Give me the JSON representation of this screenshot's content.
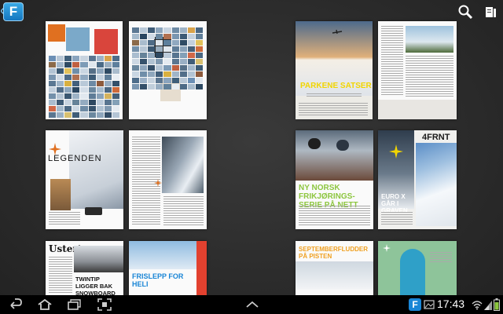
{
  "app": {
    "logo_letter": "F"
  },
  "spreads": {
    "s2_left_title": "PARKENE SATSER",
    "s3_title": "LEGENDEN",
    "s4_title": "NY NORSK FRIKJØRINGS-SERIE PÅ NETT",
    "s4_right_brand": "4FRNT",
    "s4_right_title": "EURO X GÅR I GRAVEN",
    "s5_left_mast": "Ustert",
    "s5_left_title": "TWINTIP LIGGER BAK SNOWBOARD",
    "s5_right_title": "FRISLEPP FOR HELI",
    "s6_left_title": "SEPTEMBERFLUDDER PÅ PISTEN"
  },
  "status": {
    "time": "17:43"
  },
  "colors": {
    "accent": "#1a86d6",
    "yellow": "#f0c020",
    "green": "#8dc63f"
  }
}
